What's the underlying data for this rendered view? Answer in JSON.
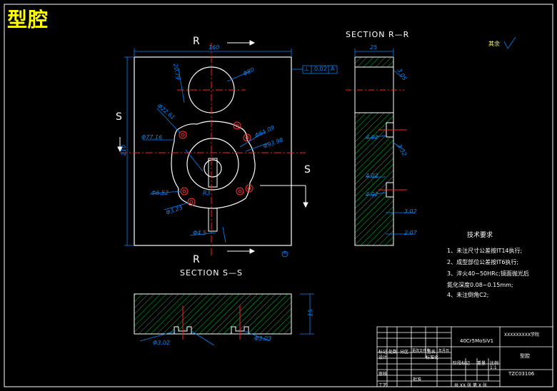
{
  "title": "型腔",
  "labels": {
    "section_ss": "SECTION S—S",
    "section_rr": "SECTION R—R",
    "r_top": "R",
    "r_bottom": "R",
    "s_left": "S",
    "s_right": "S",
    "roughness_rest": "其余"
  },
  "dimensions": {
    "width_top": "160",
    "height_left": "210",
    "dia_top": "Φ80",
    "dia_61": "Φ61.09",
    "dia_93": "Φ93.98",
    "dia_77": "Φ77.16",
    "dia_22": "Φ22.61",
    "dia_r3": "R3",
    "dia_652": "Φ6.52",
    "dia_323": "Φ3.23",
    "dim_2079": "20.79",
    "dia_45": "Φ4.5",
    "rr_width": "25",
    "rr_305": "3.05",
    "rr_402": "4.02",
    "rr_332": "3.32",
    "rr_402b": "4.02",
    "rr_3_02": "3.02",
    "rr_2_07": "2.07",
    "rr_4_02c": "4.02",
    "bottom_height": "15",
    "bottom_d1": "Φ3.02",
    "bottom_d2": "Φ3.03"
  },
  "tolerance_frame": [
    "⊥",
    "0.02",
    "A"
  ],
  "datum": "A",
  "tech_requirements": {
    "heading": "技术要求",
    "items": [
      "1、未注尺寸公差按IT14执行;",
      "2、成型部位公差按IT6执行;",
      "3、淬火40~50HRc;镜面抛光后",
      "氮化深度0.08~0.15mm;",
      "4、未注倒角C2;"
    ]
  },
  "title_block": {
    "material": "40Cr5MoSiV1",
    "company": "XXXXXXXXX学院",
    "part_name": "型腔",
    "drawing_no": "TZC03106",
    "scale_label": "比例",
    "scale": "1:1",
    "sheet": "共 XX 张 第 X 张",
    "rows": [
      "标记",
      "处数",
      "分区",
      "更改文件号",
      "签名",
      "年月日"
    ],
    "design": "设计",
    "standard": "标准化",
    "stage": "阶段标记",
    "weight": "重量",
    "review": "审核",
    "process": "工艺",
    "approve": "批准"
  },
  "colors": {
    "outline": "#ffffff",
    "dimension": "#0088ff",
    "center": "#ff2020",
    "hatch": "#00c040",
    "title": "#ffff00"
  }
}
